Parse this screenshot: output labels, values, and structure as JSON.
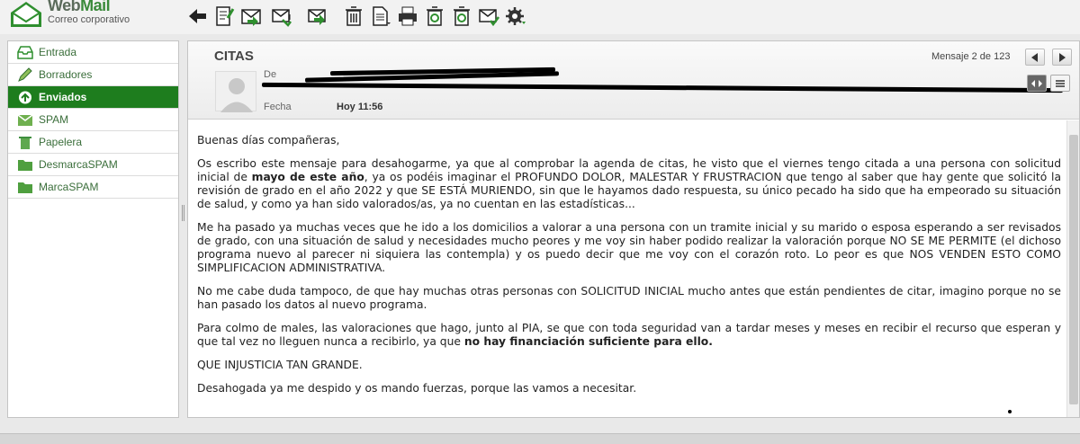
{
  "app": {
    "logo_title_a": "Web",
    "logo_title_b": "Mail",
    "logo_subtitle": "Correo corporativo"
  },
  "toolbar": {
    "icons": [
      "back-arrow-icon",
      "compose-icon",
      "reply-icon",
      "reply-all-icon",
      "forward-icon",
      "delete-icon",
      "document-menu-icon",
      "print-icon",
      "spam-icon",
      "not-spam-icon",
      "mark-icon",
      "settings-icon"
    ]
  },
  "sidebar": {
    "items": [
      {
        "label": "Entrada",
        "icon": "inbox-icon"
      },
      {
        "label": "Borradores",
        "icon": "pencil-icon"
      },
      {
        "label": "Enviados",
        "icon": "sent-icon",
        "active": true
      },
      {
        "label": "SPAM",
        "icon": "spam-icon"
      },
      {
        "label": "Papelera",
        "icon": "trash-icon"
      },
      {
        "label": "DesmarcaSPAM",
        "icon": "folder-icon"
      },
      {
        "label": "MarcaSPAM",
        "icon": "folder-icon"
      }
    ]
  },
  "message": {
    "subject": "CITAS",
    "counter": "Mensaje 2 de 123",
    "from_label": "De",
    "date_label": "Fecha",
    "date_value": "Hoy 11:56",
    "body": {
      "greeting": "Buenas días compañeras,",
      "p1_a": "Os escribo este mensaje para desahogarme, ya que al comprobar la agenda de citas, he visto que el viernes tengo citada a una persona con solicitud inicial de ",
      "p1_b": "mayo de este año",
      "p1_c": ", ya os podéis imaginar el PROFUNDO DOLOR, MALESTAR Y FRUSTRACION que tengo al saber que hay gente que solicitó la revisión de grado en el año 2022 y que SE ESTÁ MURIENDO, sin que le hayamos dado respuesta, su único pecado ha sido que ha empeorado su situación de salud, y como ya han sido valorados/as, ya no cuentan en las estadísticas...",
      "p2": "Me ha pasado ya muchas veces que he ido a los domicilios a valorar a una persona con un tramite inicial y su marido o esposa esperando a ser revisados de grado, con una situación de salud y necesidades mucho peores y me voy sin haber podido realizar la valoración porque NO SE ME PERMITE (el dichoso programa nuevo al parecer ni siquiera las contempla) y os puedo decir que me voy con el corazón roto. Lo peor es que NOS VENDEN ESTO COMO SIMPLIFICACION ADMINISTRATIVA.",
      "p3": "No me cabe duda tampoco, de que hay muchas otras personas con SOLICITUD INICIAL mucho antes que están pendientes de citar, imagino porque no se han pasado los datos al nuevo programa.",
      "p4_a": "Para colmo de males, las valoraciones que hago, junto al PIA, se que con toda seguridad van a tardar meses y meses en recibir el recurso que esperan y que tal vez no lleguen nunca a recibirlo, ya que ",
      "p4_b": "no hay financiación suficiente para ello.",
      "p5": "QUE INJUSTICIA TAN GRANDE.",
      "p6": "Desahogada ya me despido y os mando fuerzas, porque las vamos a necesitar."
    }
  },
  "colors": {
    "accent": "#1e7d1e",
    "link": "#3a6e3a"
  }
}
